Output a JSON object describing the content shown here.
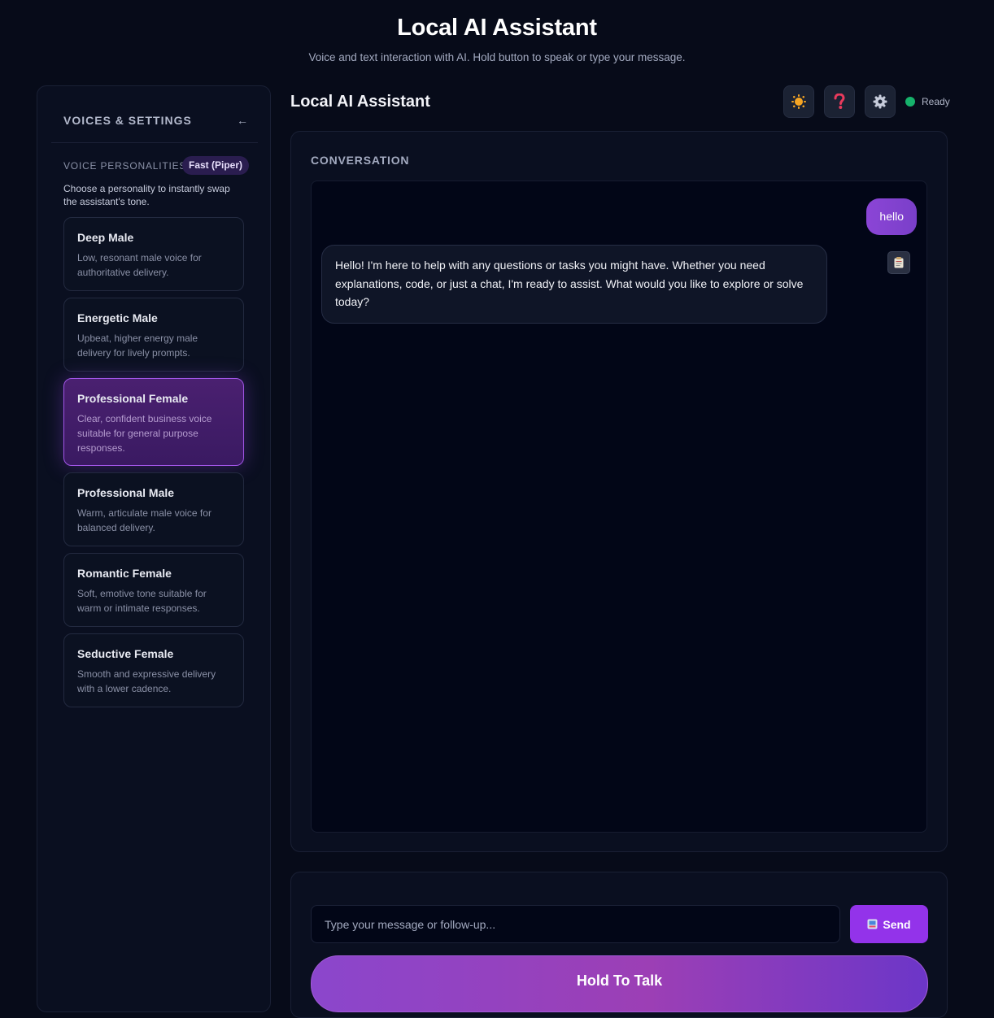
{
  "header": {
    "title": "Local AI Assistant",
    "subtitle": "Voice and text interaction with AI. Hold button to speak or type your message."
  },
  "sidebar": {
    "title": "VOICES & SETTINGS",
    "collapse_icon": "←",
    "section_label": "VOICE PERSONALITIES",
    "speed_badge": "Fast (Piper)",
    "description": "Choose a personality to instantly swap the assistant's tone.",
    "voices": [
      {
        "name": "Deep Male",
        "desc": "Low, resonant male voice for authoritative delivery.",
        "active": false
      },
      {
        "name": "Energetic Male",
        "desc": "Upbeat, higher energy male delivery for lively prompts.",
        "active": false
      },
      {
        "name": "Professional Female",
        "desc": "Clear, confident business voice suitable for general purpose responses.",
        "active": true
      },
      {
        "name": "Professional Male",
        "desc": "Warm, articulate male voice for balanced delivery.",
        "active": false
      },
      {
        "name": "Romantic Female",
        "desc": "Soft, emotive tone suitable for warm or intimate responses.",
        "active": false
      },
      {
        "name": "Seductive Female",
        "desc": "Smooth and expressive delivery with a lower cadence.",
        "active": false
      }
    ]
  },
  "main": {
    "title": "Local AI Assistant",
    "toolbar": {
      "theme_icon": "sun-icon",
      "help_icon": "question-icon",
      "settings_icon": "gear-icon"
    },
    "status": {
      "text": "Ready",
      "color": "#16b26b"
    },
    "conversation": {
      "label": "CONVERSATION",
      "messages": [
        {
          "role": "user",
          "text": "hello"
        },
        {
          "role": "assistant",
          "text": "Hello! I'm here to help with any questions or tasks you might have. Whether you need explanations, code, or just a chat, I'm ready to assist. What would you like to explore or solve today?"
        }
      ]
    },
    "input": {
      "placeholder": "Type your message or follow-up...",
      "value": "",
      "send_label": "Send",
      "talk_label": "Hold To Talk"
    }
  },
  "colors": {
    "background": "#070b19",
    "accent": "#9333ea",
    "user_bubble": "#8b45d6"
  }
}
